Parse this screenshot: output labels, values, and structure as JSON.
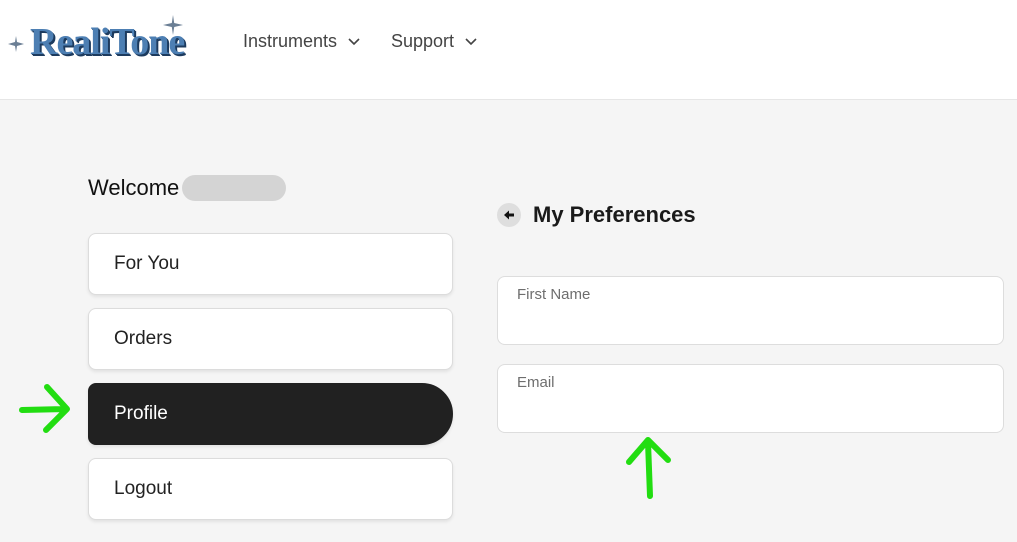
{
  "header": {
    "logo_text": "RealiTone",
    "nav": [
      {
        "label": "Instruments",
        "icon": "chevron-down-icon"
      },
      {
        "label": "Support",
        "icon": "chevron-down-icon"
      }
    ]
  },
  "sidebar": {
    "welcome": "Welcome",
    "items": [
      {
        "label": "For You",
        "active": false
      },
      {
        "label": "Orders",
        "active": false
      },
      {
        "label": "Profile",
        "active": true
      },
      {
        "label": "Logout",
        "active": false
      }
    ]
  },
  "preferences": {
    "back_icon": "arrow-left-icon",
    "title": "My Preferences",
    "fields": [
      {
        "label": "First Name",
        "value": ""
      },
      {
        "label": "Email",
        "value": ""
      }
    ]
  },
  "colors": {
    "active_item_bg": "#212121",
    "page_bg": "#f5f5f5",
    "annotation_arrow": "#22dd11",
    "logo_blue": "#4d7fb3"
  }
}
